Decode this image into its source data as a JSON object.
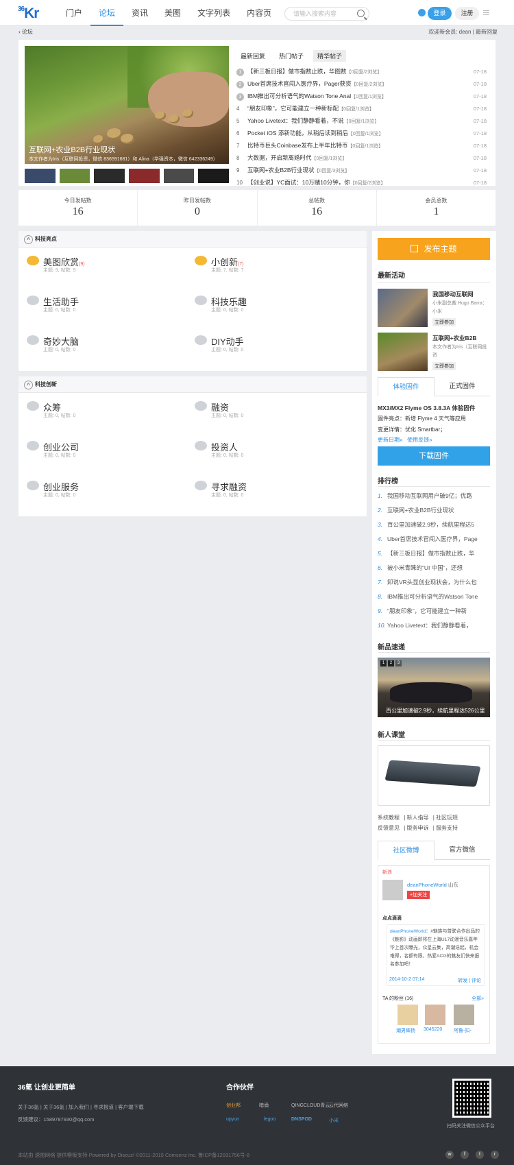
{
  "header": {
    "logo": "36Kr",
    "nav": [
      "门户",
      "论坛",
      "资讯",
      "美图",
      "文字列表",
      "内容页"
    ],
    "search_placeholder": "请输入搜索内容",
    "login": "登录",
    "register": "注册"
  },
  "breadcrumb": {
    "current": "论坛",
    "welcome": "欢迎新会员: dean",
    "latest": "最新回复"
  },
  "slide": {
    "caption": "互联网+农业B2B行业现状",
    "sub": "本文作者为Iris（互联网投资，微信 836591681）和 Alina（华强资本，微信 642336249）"
  },
  "hot_tabs": [
    "最新回复",
    "热门帖子",
    "精华帖子"
  ],
  "hot_list": [
    {
      "n": "1",
      "t": "【新三板日报】做市指数止跌，华图数",
      "s": "【0回复/2浏览】",
      "d": "07-18"
    },
    {
      "n": "2",
      "t": "Uber首席技术官闯入医疗界，Pager获资",
      "s": "【0回复/2浏览】",
      "d": "07-18"
    },
    {
      "n": "3",
      "t": "IBM推出可分析语气的Watson Tone Anal",
      "s": "【0回复/1浏览】",
      "d": "07-18"
    },
    {
      "n": "4",
      "t": "“朋友印象”，它可能建立一种新标配",
      "s": "【0回复/1浏览】",
      "d": "07-18"
    },
    {
      "n": "5",
      "t": "Yahoo Livetext：我们静静看着，不说",
      "s": "【0回复/1浏览】",
      "d": "07-18"
    },
    {
      "n": "6",
      "t": "Pocket iOS 添新功能，从稍后读到稍后",
      "s": "【0回复/1浏览】",
      "d": "07-18"
    },
    {
      "n": "7",
      "t": "比特币巨头Coinbase发布上半年比特币",
      "s": "【0回复/1浏览】",
      "d": "07-18"
    },
    {
      "n": "8",
      "t": "大数据，开启新离婚时代",
      "s": "【0回复/1浏览】",
      "d": "07-18"
    },
    {
      "n": "9",
      "t": "互联网+农业B2B行业现状",
      "s": "【0回复/3浏览】",
      "d": "07-18"
    },
    {
      "n": "10",
      "t": "【创业说】YC面试：10万赌10分钟，你",
      "s": "【0回复/2浏览】",
      "d": "07-18"
    }
  ],
  "stats": [
    {
      "l": "今日发帖数",
      "v": "16"
    },
    {
      "l": "昨日发帖数",
      "v": "0"
    },
    {
      "l": "总帖数",
      "v": "16"
    },
    {
      "l": "会员总数",
      "v": "1"
    }
  ],
  "section1": {
    "title": "科技亮点",
    "forums": [
      {
        "name": "美图欣赏",
        "new": "(9)",
        "stat": "主题: 9, 帖数: 9"
      },
      {
        "name": "小创新",
        "new": "(7)",
        "stat": "主题: 7, 帖数: 7"
      },
      {
        "name": "生活助手",
        "new": "",
        "stat": "主题: 0, 帖数: 0"
      },
      {
        "name": "科技乐趣",
        "new": "",
        "stat": "主题: 0, 帖数: 0"
      },
      {
        "name": "奇妙大脑",
        "new": "",
        "stat": "主题: 0, 帖数: 0"
      },
      {
        "name": "DIY动手",
        "new": "",
        "stat": "主题: 0, 帖数: 0"
      }
    ]
  },
  "section2": {
    "title": "科技创新",
    "forums": [
      {
        "name": "众筹",
        "new": "",
        "stat": "主题: 0, 帖数: 0"
      },
      {
        "name": "融资",
        "new": "",
        "stat": "主题: 0, 帖数: 0"
      },
      {
        "name": "创业公司",
        "new": "",
        "stat": "主题: 0, 帖数: 0"
      },
      {
        "name": "投资人",
        "new": "",
        "stat": "主题: 0, 帖数: 0"
      },
      {
        "name": "创业服务",
        "new": "",
        "stat": "主题: 0, 帖数: 0"
      },
      {
        "name": "寻求融资",
        "new": "",
        "stat": "主题: 0, 帖数: 0"
      }
    ]
  },
  "side": {
    "post": "发布主题",
    "activity_title": "最新活动",
    "act1": {
      "t": "我国移动互联网",
      "d": "小米副总裁 Hugo Barra：小米",
      "b": "立即参加"
    },
    "act2": {
      "t": "互联网+农业B2B",
      "d": "本文作者为Iris（互联网投资",
      "b": "立即参加"
    },
    "fw_tabs": [
      "体验固件",
      "正式固件"
    ],
    "fw_title": "MX3/MX2 Flyme OS 3.8.3A 体验固件",
    "fw_d1": "固件亮点：新增 Flyme 4 天气等应用",
    "fw_d2": "变更详情：优化 Smartbar；",
    "fw_l1": "更新日期»",
    "fw_l2": "使用反馈»",
    "download": "下载固件",
    "rank_title": "排行榜",
    "rank": [
      "我国移动互联网用户破9亿；优路",
      "互联网+农业B2B行业现状",
      "百公里加速破2.9秒，续航里程达5",
      "Uber首席技术官闯入医疗界，Page",
      "【新三板日报】做市指数止跌，华",
      "被小米青睐的“UI 中国”，还想",
      "卸说VR头显创业现状会，为什么也",
      "IBM推出可分析语气的Watson Tone",
      "“朋友印象”，它可能建立一种新",
      "Yahoo Livetext：我们静静看着，"
    ],
    "new_title": "新品速递",
    "car_cap": "百公里加速破2.9秒，续航里程达526公里",
    "car_dots": [
      "1",
      "2",
      "3"
    ],
    "class_title": "新人课堂",
    "links1": [
      "系统教程",
      "新人指导",
      "社区玩规"
    ],
    "links2": [
      "反馈意见",
      "版务申诉",
      "服务支持"
    ],
    "wb_tabs": [
      "社区微博",
      "官方微信"
    ],
    "wb": {
      "title": "新浪",
      "user": "deanPhoneWorld",
      "loc": "山东",
      "follow": "+加关注",
      "pt": "点点滴滴",
      "msg_user": "deanPhoneWorld",
      "msg": "：#魅族与普联合作出品的《魅影》动画即将在上海U17动漫音乐嘉年华上首次曝光，众星云集，高潮迭起，机会难得，名额有限，热爱ACG的魅友们快来报名参加吧！",
      "time": "2014-10-2 07:14",
      "op1": "转发",
      "op2": "评论",
      "fans": "TA 的粉丝 (16)",
      "all": "全部»",
      "f1": "潮男辉扬",
      "f2": "3045220",
      "f3": "阿鲁-扣-"
    }
  },
  "footer": {
    "t1": "36氪 让创业更简单",
    "t2": "合作伙伴",
    "links": "关于36氪 | 关于36氪 | 加入我们 | 寻求报道 | 客户端下载",
    "feedback": "反馈建议：1589787930@qq.com",
    "qrt": "扫码关注微信公众平台",
    "copy": "本站由 速图网络 提供模板支持   Powered by Discuz! ©2011-2015 Comsenz Inc.   鲁ICP备12031756号-8",
    "partners": [
      "创业邦",
      "暗涌",
      "QINGCLOUD青云",
      "云代网络",
      "upyun",
      "legoo",
      "DNSPOD",
      "小米"
    ]
  }
}
